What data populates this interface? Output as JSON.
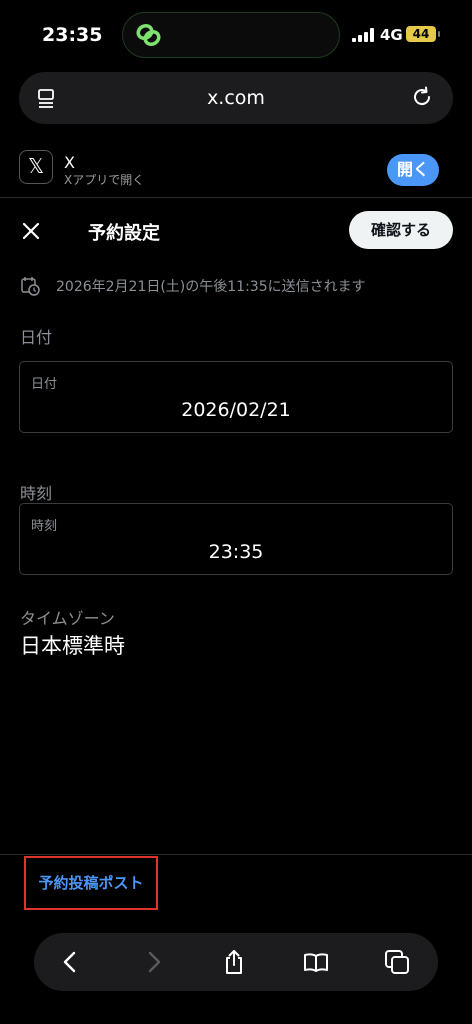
{
  "status": {
    "time": "23:35",
    "network": "4G",
    "battery": "44"
  },
  "browser": {
    "url": "x.com"
  },
  "banner": {
    "app_icon": "𝕏",
    "app_name": "X",
    "app_subtitle": "Xアプリで開く",
    "open_label": "開く"
  },
  "header": {
    "title": "予約設定",
    "confirm_label": "確認する"
  },
  "schedule": {
    "summary": "2026年2月21日(土)の午後11:35に送信されます"
  },
  "date": {
    "section_label": "日付",
    "field_label": "日付",
    "value": "2026/02/21"
  },
  "time_field": {
    "section_label": "時刻",
    "field_label": "時刻",
    "value": "23:35"
  },
  "timezone": {
    "label": "タイムゾーン",
    "value": "日本標準時"
  },
  "footer": {
    "scheduled_posts_label": "予約投稿ポスト"
  },
  "colors": {
    "accent": "#4b97f7",
    "highlight_border": "#e0332b",
    "battery": "#e6c84a"
  },
  "icons": [
    "link-icon",
    "signal-icon",
    "menu-icon",
    "reload-icon",
    "x-logo-icon",
    "close-icon",
    "calendar-clock-icon",
    "back-icon",
    "forward-icon",
    "share-icon",
    "bookmarks-icon",
    "tabs-icon"
  ]
}
